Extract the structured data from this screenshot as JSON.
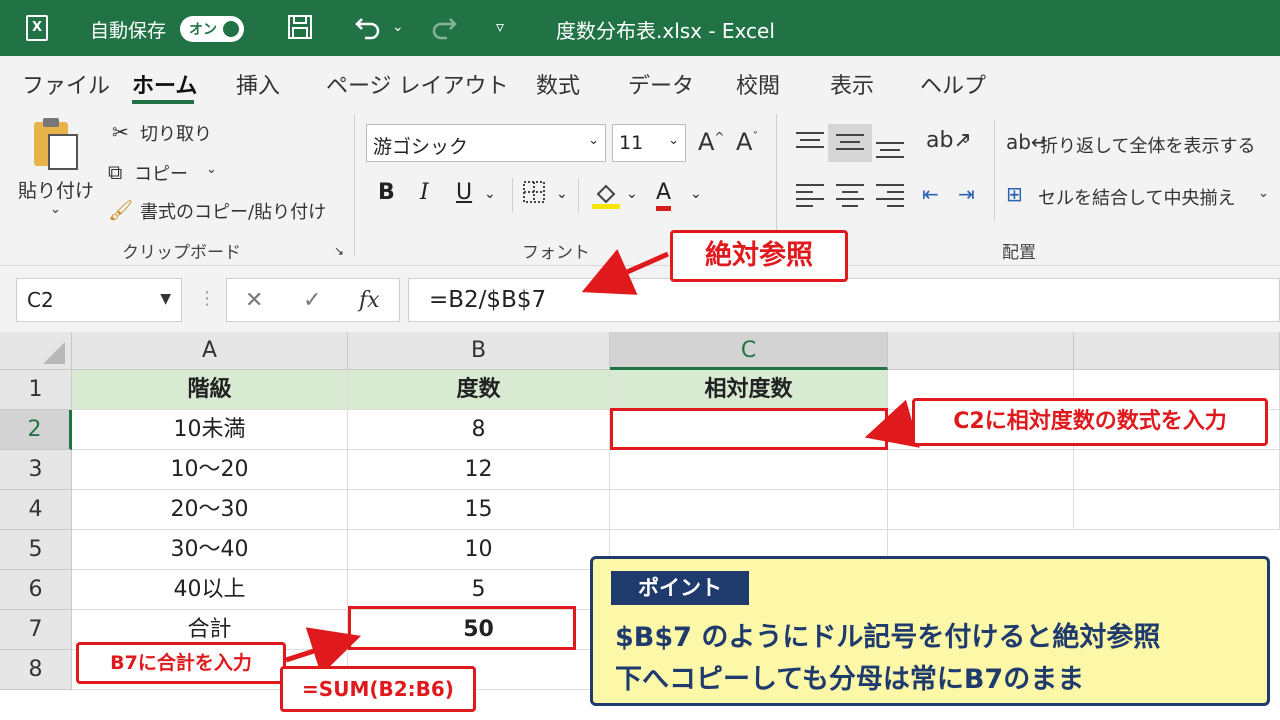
{
  "titlebar": {
    "app_icon": "excel-logo",
    "autosave_label": "自動保存",
    "autosave_state": "オン",
    "title": "度数分布表.xlsx  -  Excel"
  },
  "tabs": [
    "ファイル",
    "ホーム",
    "挿入",
    "ページ レイアウト",
    "数式",
    "データ",
    "校閲",
    "表示",
    "ヘルプ"
  ],
  "active_tab": "ホーム",
  "ribbon": {
    "clipboard": {
      "paste": "貼り付け",
      "cut": "切り取り",
      "copy": "コピー",
      "format_painter": "書式のコピー/貼り付け",
      "group_label": "クリップボード"
    },
    "font": {
      "font_name": "游ゴシック",
      "font_size": "11",
      "bold": "B",
      "italic": "I",
      "underline": "U",
      "font_color_glyph": "A",
      "group_label": "フォント"
    },
    "alignment": {
      "wrap_text": "折り返して全体を表示する",
      "merge_center": "セルを結合して中央揃え",
      "group_label": "配置"
    }
  },
  "formula_bar": {
    "name_box": "C2",
    "cancel_glyph": "✕",
    "enter_glyph": "✓",
    "fx_glyph": "fx",
    "formula": "=B2/$B$7"
  },
  "sheet": {
    "columns": [
      "A",
      "B",
      "C"
    ],
    "rows": [
      "1",
      "2",
      "3",
      "4",
      "5",
      "6",
      "7",
      "8"
    ],
    "headers": [
      "階級",
      "度数",
      "相対度数"
    ],
    "data": [
      [
        "10未満",
        "8"
      ],
      [
        "10～20",
        "12"
      ],
      [
        "20～30",
        "15"
      ],
      [
        "30～40",
        "10"
      ],
      [
        "40以上",
        "5"
      ],
      [
        "合計",
        "50"
      ]
    ]
  },
  "annotations": {
    "absolute_ref": "絶対参照",
    "c2_note": "C2に相対度数の数式を入力",
    "b7_note": "B7に合計を入力",
    "sum_formula": "=SUM(B2:B6)",
    "accent_color": "#e0191d"
  },
  "point_box": {
    "badge": "ポイント",
    "line1": "$B$7 のようにドル記号を付けると絶対参照",
    "line2": "下へコピーしても分母は常にB7のまま"
  }
}
